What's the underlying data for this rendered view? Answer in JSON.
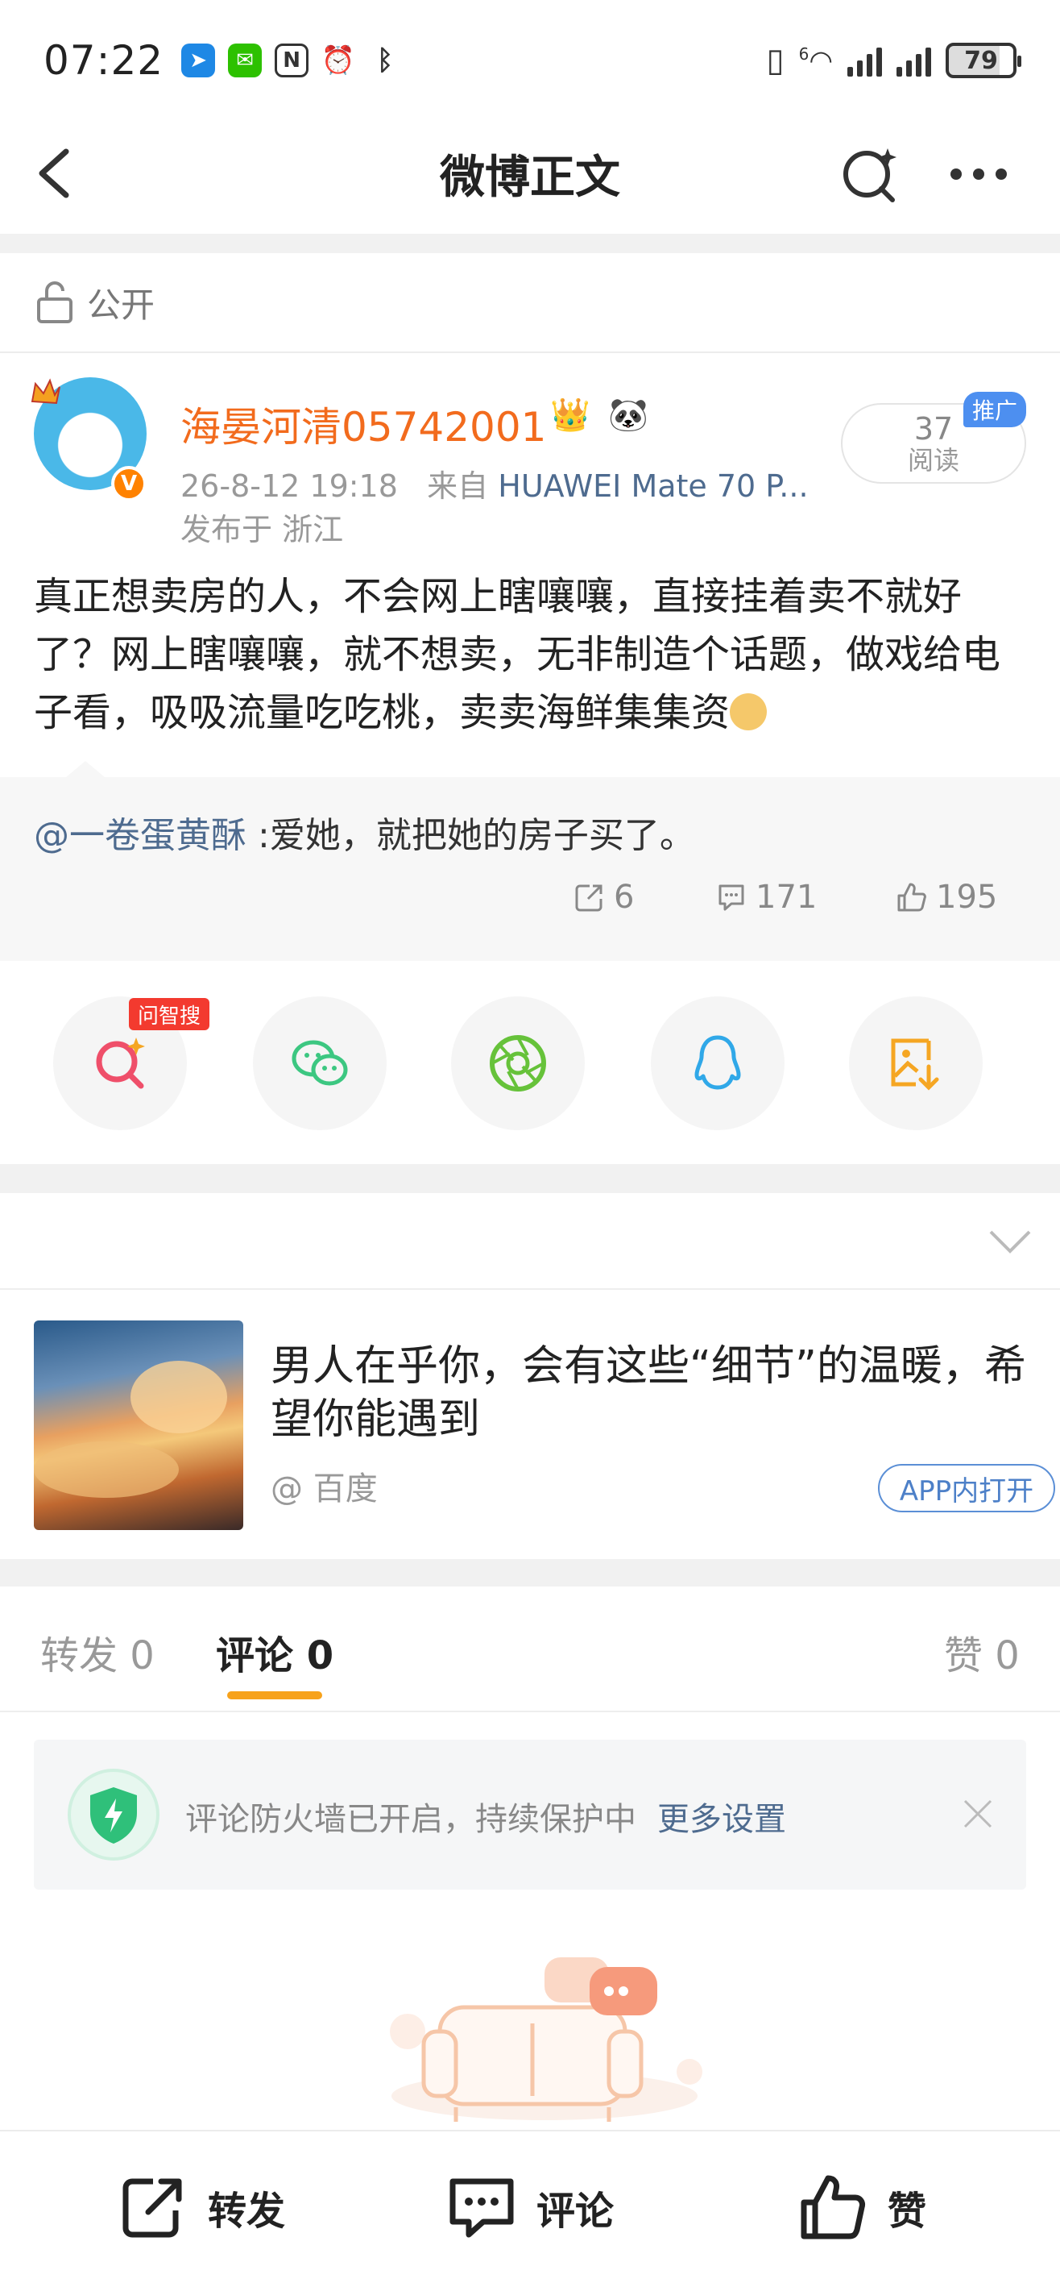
{
  "status_bar": {
    "time": "07:22",
    "battery": "79",
    "network_label": "6"
  },
  "nav": {
    "title": "微博正文"
  },
  "visibility": {
    "label": "公开"
  },
  "author": {
    "name": "海晏河清05742001",
    "meta_time": "26-8-12 19:18",
    "meta_from": "来自",
    "device": "HUAWEI Mate 70 P...",
    "location": "发布于 浙江",
    "verified_badge": "V",
    "read_count": "37",
    "read_label": "阅读",
    "promo_tag": "推广"
  },
  "post": {
    "text": "真正想卖房的人，不会网上瞎嚷嚷，直接挂着卖不就好了？网上瞎嚷嚷，就不想卖，无非制造个话题，做戏给电子看，吸吸流量吃吃桃，卖卖海鲜集集资"
  },
  "retweet": {
    "user": "@一卷蛋黄酥",
    "text": ":爱她，就把她的房子买了。",
    "reposts": "6",
    "comments": "171",
    "likes": "195"
  },
  "share": {
    "ask_tag": "问智搜",
    "targets": [
      "search-ai",
      "wechat",
      "moments",
      "qq",
      "save-image"
    ]
  },
  "ad": {
    "title": "男人在乎你，会有这些“细节”的温暖，希望你能遇到",
    "source": "@ 百度",
    "open_app": "APP内打开"
  },
  "tabs": {
    "repost": "转发 0",
    "comment": "评论 0",
    "like": "赞 0"
  },
  "firewall": {
    "text": "评论防火墙已开启，持续保护中",
    "link": "更多设置"
  },
  "toolbar": {
    "repost": "转发",
    "comment": "评论",
    "like": "赞"
  },
  "colors": {
    "accent_orange": "#f7a21b",
    "name_orange": "#f26b1d",
    "link_blue": "#4e6b8f",
    "promo_blue": "#4d8ff0"
  }
}
